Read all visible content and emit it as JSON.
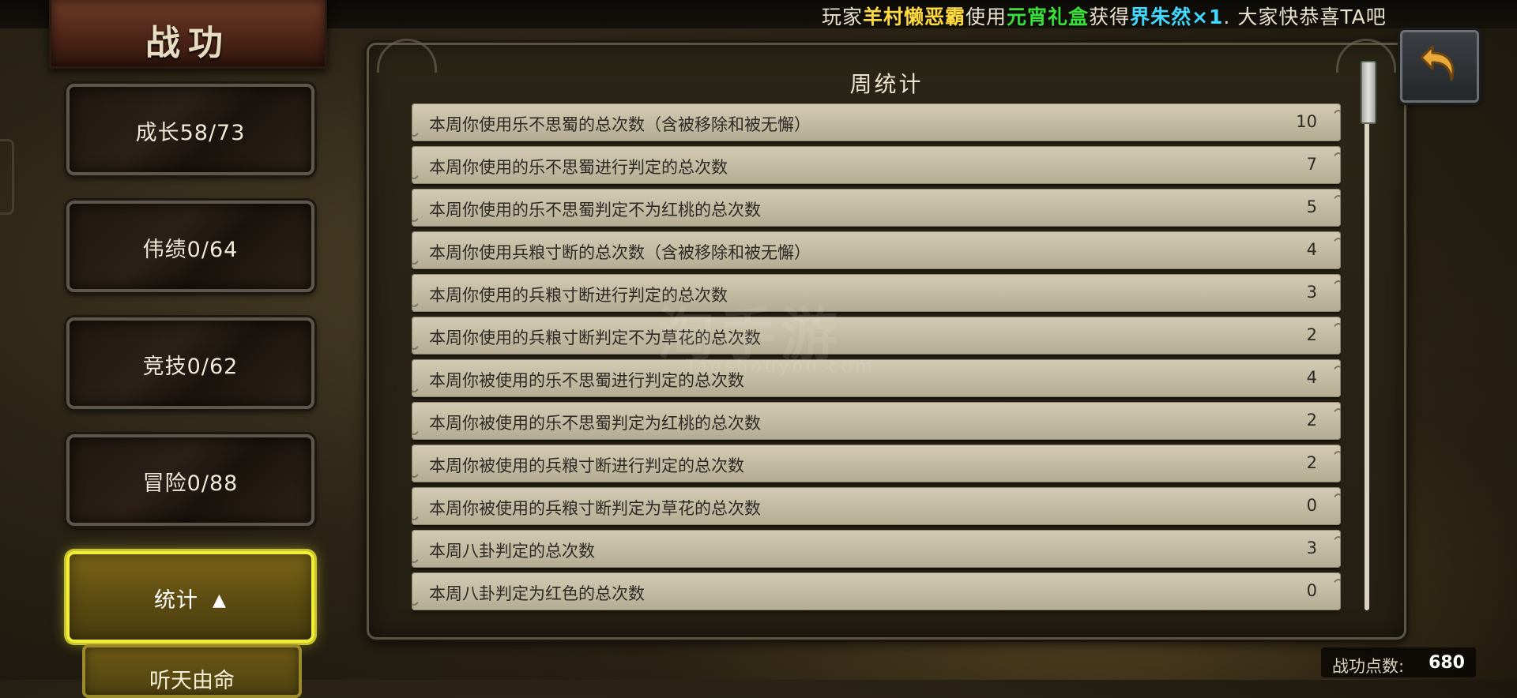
{
  "announcement": {
    "prefix": "玩家",
    "player": "羊村懒恶霸",
    "verb": "使用",
    "item": "元宵礼盒",
    "got": "获得",
    "reward": "界朱然×1",
    "suffix": ". 大家快恭喜TA吧"
  },
  "title": "战功",
  "tabs": [
    {
      "label": "成长58/73"
    },
    {
      "label": "伟绩0/64"
    },
    {
      "label": "竞技0/62"
    },
    {
      "label": "冒险0/88"
    },
    {
      "label": "统计",
      "arrow": "▲"
    }
  ],
  "subtab": {
    "label": "听天由命"
  },
  "panel": {
    "title": "周统计",
    "rows": [
      {
        "label": "本周你使用乐不思蜀的总次数（含被移除和被无懈）",
        "value": "10"
      },
      {
        "label": "本周你使用的乐不思蜀进行判定的总次数",
        "value": "7"
      },
      {
        "label": "本周你使用的乐不思蜀判定不为红桃的总次数",
        "value": "5"
      },
      {
        "label": "本周你使用兵粮寸断的总次数（含被移除和被无懈）",
        "value": "4"
      },
      {
        "label": "本周你使用的兵粮寸断进行判定的总次数",
        "value": "3"
      },
      {
        "label": "本周你使用的兵粮寸断判定不为草花的总次数",
        "value": "2"
      },
      {
        "label": "本周你被使用的乐不思蜀进行判定的总次数",
        "value": "4"
      },
      {
        "label": "本周你被使用的乐不思蜀判定为红桃的总次数",
        "value": "2"
      },
      {
        "label": "本周你被使用的兵粮寸断进行判定的总次数",
        "value": "2"
      },
      {
        "label": "本周你被使用的兵粮寸断判定为草花的总次数",
        "value": "0"
      },
      {
        "label": "本周八卦判定的总次数",
        "value": "3"
      },
      {
        "label": "本周八卦判定为红色的总次数",
        "value": "0"
      }
    ]
  },
  "watermark": {
    "main": "淘手游",
    "sub": "Taoshouyou.com"
  },
  "score": {
    "label": "战功点数:",
    "value": "680"
  },
  "icons": {
    "back": "back-arrow-icon"
  },
  "colors": {
    "highlight_player": "#ffd940",
    "highlight_item": "#38e03a",
    "highlight_reward": "#3fd8ff",
    "active_tab_border": "#f1ee3a"
  }
}
